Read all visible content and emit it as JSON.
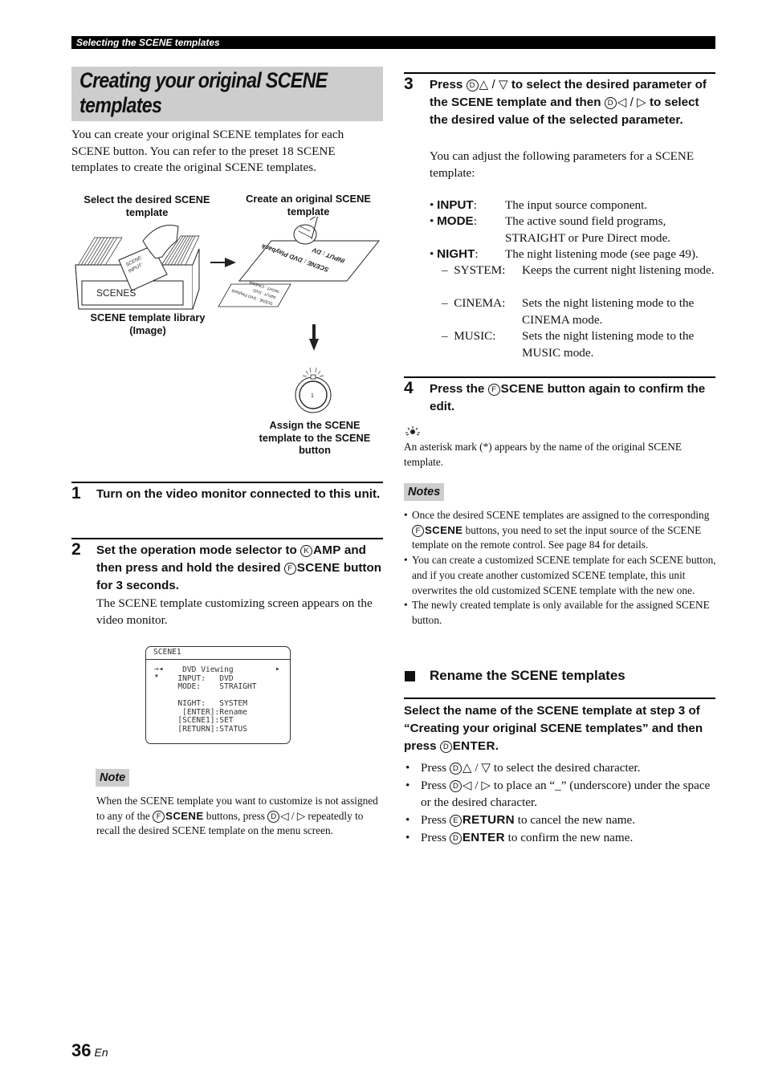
{
  "header": {
    "section_title": "Selecting the SCENE templates"
  },
  "title": "Creating your original SCENE templates",
  "intro": "You can create your original SCENE templates for each SCENE button. You can refer to the preset 18 SCENE templates to create the original SCENE templates.",
  "diagram": {
    "label_select": "Select the desired SCENE template",
    "label_create": "Create an original SCENE template",
    "label_library": "SCENE template library (Image)",
    "label_assign": "Assign the SCENE template to the SCENE button",
    "box_label": "SCENES",
    "card_lines": [
      "SCENE:",
      "INPUT:"
    ],
    "template_lines": [
      "SCENE : DVD Playback",
      "INPUT : DV"
    ],
    "small_card_lines": [
      "SCENE : DVD Playback",
      "INPUT : DVD",
      "NIGHT : CINEMA"
    ],
    "button_number": "1"
  },
  "steps": [
    {
      "number": "1",
      "text": "Turn on the video monitor connected to this unit."
    },
    {
      "number": "2",
      "text_a": "Set the operation mode selector to ",
      "key_a_circle": "K",
      "key_a": "AMP",
      "text_b": " and then press and hold the desired ",
      "key_b_circle": "F",
      "key_b": "SCENE",
      "text_c": " button for 3 seconds.",
      "body": "The SCENE template customizing screen appears on the video monitor."
    },
    {
      "number": "3",
      "text_a": "Press ",
      "circle": "D",
      "updown": "△ / ▽",
      "text_b": " to select the desired parameter of the SCENE template and then ",
      "leftright": "◁ / ▷",
      "text_c": " to select the desired value of the selected parameter.",
      "body": "You can adjust the following parameters for a SCENE template:"
    },
    {
      "number": "4",
      "text_a": "Press the ",
      "circle": "F",
      "key": "SCENE",
      "text_b": " button again to confirm the edit."
    }
  ],
  "osd": {
    "title": "SCENE1",
    "lines": [
      "    DVD Viewing",
      "   INPUT:   DVD",
      "   MODE:    STRAIGHT",
      "",
      "   NIGHT:   SYSTEM",
      "    [ENTER]:Rename",
      "   [SCENE1]:SET",
      "   [RETURN]:STATUS"
    ],
    "nav_left": "→◂",
    "nav_down": "▾",
    "nav_right": "▸"
  },
  "note_left": {
    "tag": "Note",
    "text_a": "When the SCENE template you want to customize is not assigned to any of the ",
    "circle_a": "F",
    "key_a": "SCENE",
    "text_b": " buttons, press ",
    "circle_b": "D",
    "arrows": "◁ / ▷",
    "text_c": " repeatedly to recall the desired SCENE template on the menu screen."
  },
  "parameters": [
    {
      "name": "INPUT",
      "desc": "The input source component."
    },
    {
      "name": "MODE",
      "desc": "The active sound field programs, STRAIGHT or Pure Direct mode."
    },
    {
      "name": "NIGHT",
      "desc": "The night listening mode (see page 49)."
    }
  ],
  "night_options": [
    {
      "name": "SYSTEM:",
      "desc": "Keeps the current night listening mode."
    },
    {
      "name": "CINEMA:",
      "desc": "Sets the night listening mode to the CINEMA mode."
    },
    {
      "name": "MUSIC:",
      "desc": "Sets the night listening mode to the MUSIC mode."
    }
  ],
  "tip": {
    "icon": "tip-lightbulb",
    "text": "An asterisk mark (*) appears by the name of the original SCENE template."
  },
  "notes_right": {
    "tag": "Notes",
    "items": [
      {
        "text_a": "Once the desired SCENE templates are assigned to the corresponding ",
        "circle": "F",
        "key": "SCENE",
        "text_b": " buttons, you need to set the input source of the SCENE template on the remote control. See page 84 for details."
      },
      {
        "text_a": "You can create a customized SCENE template for each SCENE button, and if you create another customized SCENE template, this unit overwrites the old customized SCENE template with the new one."
      },
      {
        "text_a": "The newly created template is only available for the assigned SCENE button."
      }
    ]
  },
  "rename": {
    "heading": "Rename the SCENE templates",
    "instruction_a": "Select the name of the SCENE template at step 3 of “Creating your original SCENE templates” and then press ",
    "instruction_circle": "D",
    "instruction_key": "ENTER",
    "instruction_b": ".",
    "bullets": [
      {
        "a": "Press ",
        "circle": "D",
        "sym": "△ / ▽",
        "b": " to select the desired character."
      },
      {
        "a": "Press ",
        "circle": "D",
        "sym": "◁ / ▷",
        "b": " to place an “_” (underscore) under the space or the desired character."
      },
      {
        "a": "Press ",
        "circle": "E",
        "key": "RETURN",
        "b": " to cancel the new name."
      },
      {
        "a": "Press ",
        "circle": "D",
        "key": "ENTER",
        "b": " to confirm the new name."
      }
    ]
  },
  "footer": {
    "page_number": "36",
    "language": "En"
  }
}
